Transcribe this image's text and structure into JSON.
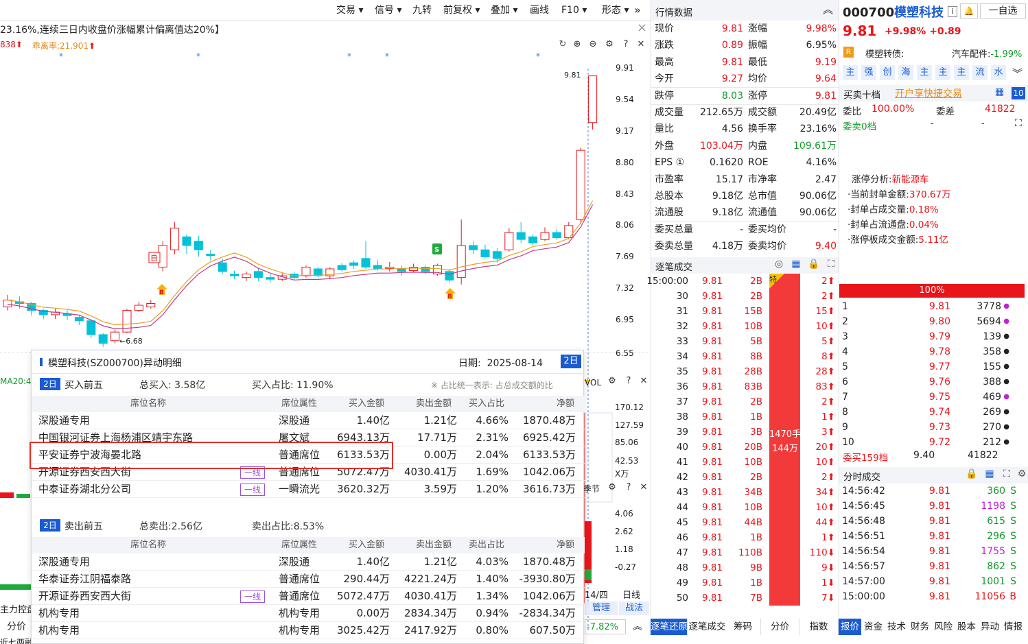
{
  "toolbar": {
    "items": [
      "交易",
      "信号",
      "九转",
      "前复权",
      "叠加",
      "画线",
      "F10",
      "形态"
    ],
    "more": "»"
  },
  "alert": {
    "text": "23.16%,连续三日内收盘价涨幅累计偏离值达20%】",
    "close": "×"
  },
  "indicators": {
    "left": "838",
    "label": "乖离率:21.901"
  },
  "price_axis": [
    "9.91",
    "9.54",
    "9.17",
    "8.80",
    "8.43",
    "8.06",
    "7.69",
    "7.32",
    "6.95",
    "6.55"
  ],
  "chart_marks": {
    "high": "9.81",
    "low": "6.68",
    "zi": "自",
    "b1": "B",
    "b2": "B",
    "s": "S"
  },
  "vol_axis": [
    "170.12",
    "127.59",
    "85.06",
    "42.53",
    "X万"
  ],
  "vol_label": "VOL",
  "ma_label": "MA20:4",
  "season_label": "季节",
  "macd_axis": [
    "4.06",
    "2.62",
    "1.18",
    "-0.27"
  ],
  "bottom_left": {
    "zl": "主力控盘",
    "fj": "分价",
    "date": "14/四",
    "rx": "日线",
    "manage": "管理",
    "zhanfa": "战法",
    "pct": "-7.82%",
    "sub": "近七两融"
  },
  "popup": {
    "title": "模塑科技(SZ000700)异动明细",
    "date_label": "日期:",
    "date": "2025-08-14",
    "days": "2日",
    "buy": {
      "tag": "2日",
      "title": "买入前五",
      "total": "总买入: 3.58亿",
      "ratio": "买入占比: 11.90%",
      "note": "※ 占比统一表示: 占总成交额的比",
      "headers": [
        "席位名称",
        "席位属性",
        "买入金额",
        "卖出金额",
        "买入占比",
        "净额"
      ],
      "rows": [
        {
          "name": "深股通专用",
          "tag": "",
          "attr": "深股通",
          "buy": "1.40亿",
          "sell": "1.21亿",
          "ratio": "4.66%",
          "net": "1870.48万"
        },
        {
          "name": "中国银河证券上海杨浦区靖宇东路",
          "tag": "",
          "attr": "屠文斌",
          "buy": "6943.13万",
          "sell": "17.71万",
          "ratio": "2.31%",
          "net": "6925.42万"
        },
        {
          "name": "平安证券宁波海晏北路",
          "tag": "",
          "attr": "普通席位",
          "buy": "6133.53万",
          "sell": "0.00万",
          "ratio": "2.04%",
          "net": "6133.53万"
        },
        {
          "name": "开源证券西安西大街",
          "tag": "一线",
          "attr": "普通席位",
          "buy": "5072.47万",
          "sell": "4030.41万",
          "ratio": "1.69%",
          "net": "1042.06万"
        },
        {
          "name": "中泰证券湖北分公司",
          "tag": "一线",
          "attr": "一瞬流光",
          "buy": "3620.32万",
          "sell": "3.59万",
          "ratio": "1.20%",
          "net": "3616.73万"
        }
      ]
    },
    "sell": {
      "tag": "2日",
      "title": "卖出前五",
      "total": "总卖出:2.56亿",
      "ratio": "卖出占比:8.53%",
      "headers": [
        "席位名称",
        "席位属性",
        "买入金额",
        "卖出金额",
        "卖出占比",
        "净额"
      ],
      "rows": [
        {
          "name": "深股通专用",
          "tag": "",
          "attr": "深股通",
          "buy": "1.40亿",
          "sell": "1.21亿",
          "ratio": "4.03%",
          "net": "1870.48万"
        },
        {
          "name": "华泰证券江阴福泰路",
          "tag": "",
          "attr": "普通席位",
          "buy": "290.44万",
          "sell": "4221.24万",
          "ratio": "1.40%",
          "net": "-3930.80万"
        },
        {
          "name": "开源证券西安西大街",
          "tag": "一线",
          "attr": "普通席位",
          "buy": "5072.47万",
          "sell": "4030.41万",
          "ratio": "1.34%",
          "net": "1042.06万"
        },
        {
          "name": "机构专用",
          "tag": "",
          "attr": "机构专用",
          "buy": "0.00万",
          "sell": "2834.34万",
          "ratio": "0.94%",
          "net": "-2834.34万"
        },
        {
          "name": "机构专用",
          "tag": "",
          "attr": "机构专用",
          "buy": "3025.42万",
          "sell": "2417.92万",
          "ratio": "0.80%",
          "net": "607.50万"
        }
      ]
    }
  },
  "quote": {
    "title": "行情数据",
    "rows": [
      [
        "现价",
        "9.81",
        "涨幅",
        "9.98%"
      ],
      [
        "涨跌",
        "0.89",
        "振幅",
        "6.95%"
      ],
      [
        "最高",
        "9.81",
        "最低",
        "9.19"
      ],
      [
        "今开",
        "9.27",
        "均价",
        "9.64"
      ],
      [
        "跌停",
        "8.03",
        "涨停",
        "9.81"
      ],
      [
        "成交量",
        "212.65万",
        "成交额",
        "20.49亿"
      ],
      [
        "量比",
        "4.56",
        "换手率",
        "23.16%"
      ],
      [
        "外盘",
        "103.04万",
        "内盘",
        "109.61万"
      ],
      [
        "EPS ①",
        "0.1620",
        "ROE",
        "4.16%"
      ],
      [
        "市盈率",
        "15.17",
        "市净率",
        "2.47"
      ],
      [
        "总股本",
        "9.18亿",
        "总市值",
        "90.06亿"
      ],
      [
        "流通股",
        "9.18亿",
        "流通值",
        "90.06亿"
      ],
      [
        "委买总量",
        "-",
        "委买均价",
        "-"
      ],
      [
        "委卖总量",
        "4.18万",
        "委卖均价",
        "9.40"
      ]
    ]
  },
  "ticks": {
    "title": "逐笔成交",
    "first_time": "15:00:00",
    "rows": [
      [
        "15:00:00",
        "9.81",
        "2",
        "2"
      ],
      [
        "30",
        "9.81",
        "2",
        "2"
      ],
      [
        "31",
        "9.81",
        "15",
        "15"
      ],
      [
        "32",
        "9.81",
        "10",
        "10"
      ],
      [
        "33",
        "9.81",
        "5",
        "5"
      ],
      [
        "34",
        "9.81",
        "8",
        "8"
      ],
      [
        "35",
        "9.81",
        "28",
        "28"
      ],
      [
        "36",
        "9.81",
        "83",
        "83"
      ],
      [
        "37",
        "9.81",
        "2",
        "2"
      ],
      [
        "38",
        "9.81",
        "1",
        "1"
      ],
      [
        "39",
        "9.81",
        "3",
        "3"
      ],
      [
        "40",
        "9.81",
        "20",
        "20"
      ],
      [
        "41",
        "9.81",
        "10",
        "10"
      ],
      [
        "42",
        "9.81",
        "2",
        "2"
      ],
      [
        "43",
        "9.81",
        "34",
        "34"
      ],
      [
        "44",
        "9.81",
        "10",
        "10"
      ],
      [
        "45",
        "9.81",
        "44",
        "44"
      ],
      [
        "46",
        "9.81",
        "1",
        "1"
      ],
      [
        "47",
        "9.81",
        "110",
        "110"
      ],
      [
        "48",
        "9.81",
        "9",
        "9"
      ],
      [
        "49",
        "9.81",
        "1",
        "1"
      ],
      [
        "50",
        "9.81",
        "7",
        "7"
      ]
    ],
    "bar_label1": "1470手",
    "bar_label2": "144万",
    "te": "特",
    "b": "B"
  },
  "stock": {
    "code": "000700",
    "name": "模塑科技",
    "price": "9.81",
    "chg_pct": "+9.98%",
    "chg": "+0.89",
    "bell": "🔔",
    "watch": "一自选",
    "badge_r": "R",
    "concept1": "模塑转债:",
    "concept2": "汽车配件:",
    "concept2_val": "-1.99%",
    "tags": [
      "主",
      "强",
      "创",
      "海",
      "主",
      "主",
      "主",
      "流",
      "水"
    ]
  },
  "orderbook": {
    "title": "买卖十档",
    "promo": "开户享快捷交易",
    "wb_label": "委比",
    "wb": "100.00%",
    "wc_label": "委差",
    "wc": "41822",
    "sell0": "委卖0档",
    "dash": "-",
    "pct100": "100%",
    "levels": [
      [
        "1",
        "9.81",
        "3778"
      ],
      [
        "2",
        "9.80",
        "5694"
      ],
      [
        "3",
        "9.79",
        "139"
      ],
      [
        "4",
        "9.78",
        "358"
      ],
      [
        "5",
        "9.77",
        "155"
      ],
      [
        "6",
        "9.76",
        "388"
      ],
      [
        "7",
        "9.75",
        "469"
      ],
      [
        "8",
        "9.74",
        "269"
      ],
      [
        "9",
        "9.73",
        "270"
      ],
      [
        "10",
        "9.72",
        "212"
      ]
    ],
    "sell159": "委买159档",
    "sell159_price": "9.40",
    "sell159_vol": "41822"
  },
  "limit": {
    "label": "涨停分析:",
    "reason": "新能源车",
    "items": [
      [
        "·当前封单金额:",
        "370.67万"
      ],
      [
        "·封单占成交量:",
        "0.18%"
      ],
      [
        "·封单占流通盘:",
        "0.04%"
      ],
      [
        "·涨停板成交金额:",
        "5.11亿"
      ]
    ]
  },
  "fenshi": {
    "title": "分时成交",
    "rows": [
      [
        "14:56:42",
        "9.81",
        "360",
        "S"
      ],
      [
        "14:56:45",
        "9.81",
        "1198",
        "S"
      ],
      [
        "14:56:48",
        "9.81",
        "615",
        "S"
      ],
      [
        "14:56:51",
        "9.81",
        "296",
        "S"
      ],
      [
        "14:56:54",
        "9.81",
        "1755",
        "S"
      ],
      [
        "14:56:57",
        "9.81",
        "862",
        "S"
      ],
      [
        "14:57:00",
        "9.81",
        "1001",
        "S"
      ],
      [
        "15:00:00",
        "9.81",
        "11056",
        "B"
      ]
    ]
  },
  "bottom_tabs_mid": [
    "逐笔还原",
    "逐笔成交",
    "筹码",
    "分价",
    "指数"
  ],
  "bottom_tabs_right": [
    "报价",
    "资金",
    "技术",
    "财务",
    "风险",
    "股本",
    "异动",
    "情报"
  ],
  "colors": {
    "up": "#e8151b",
    "down": "#00c2d9",
    "accent": "#1a5bd1"
  }
}
